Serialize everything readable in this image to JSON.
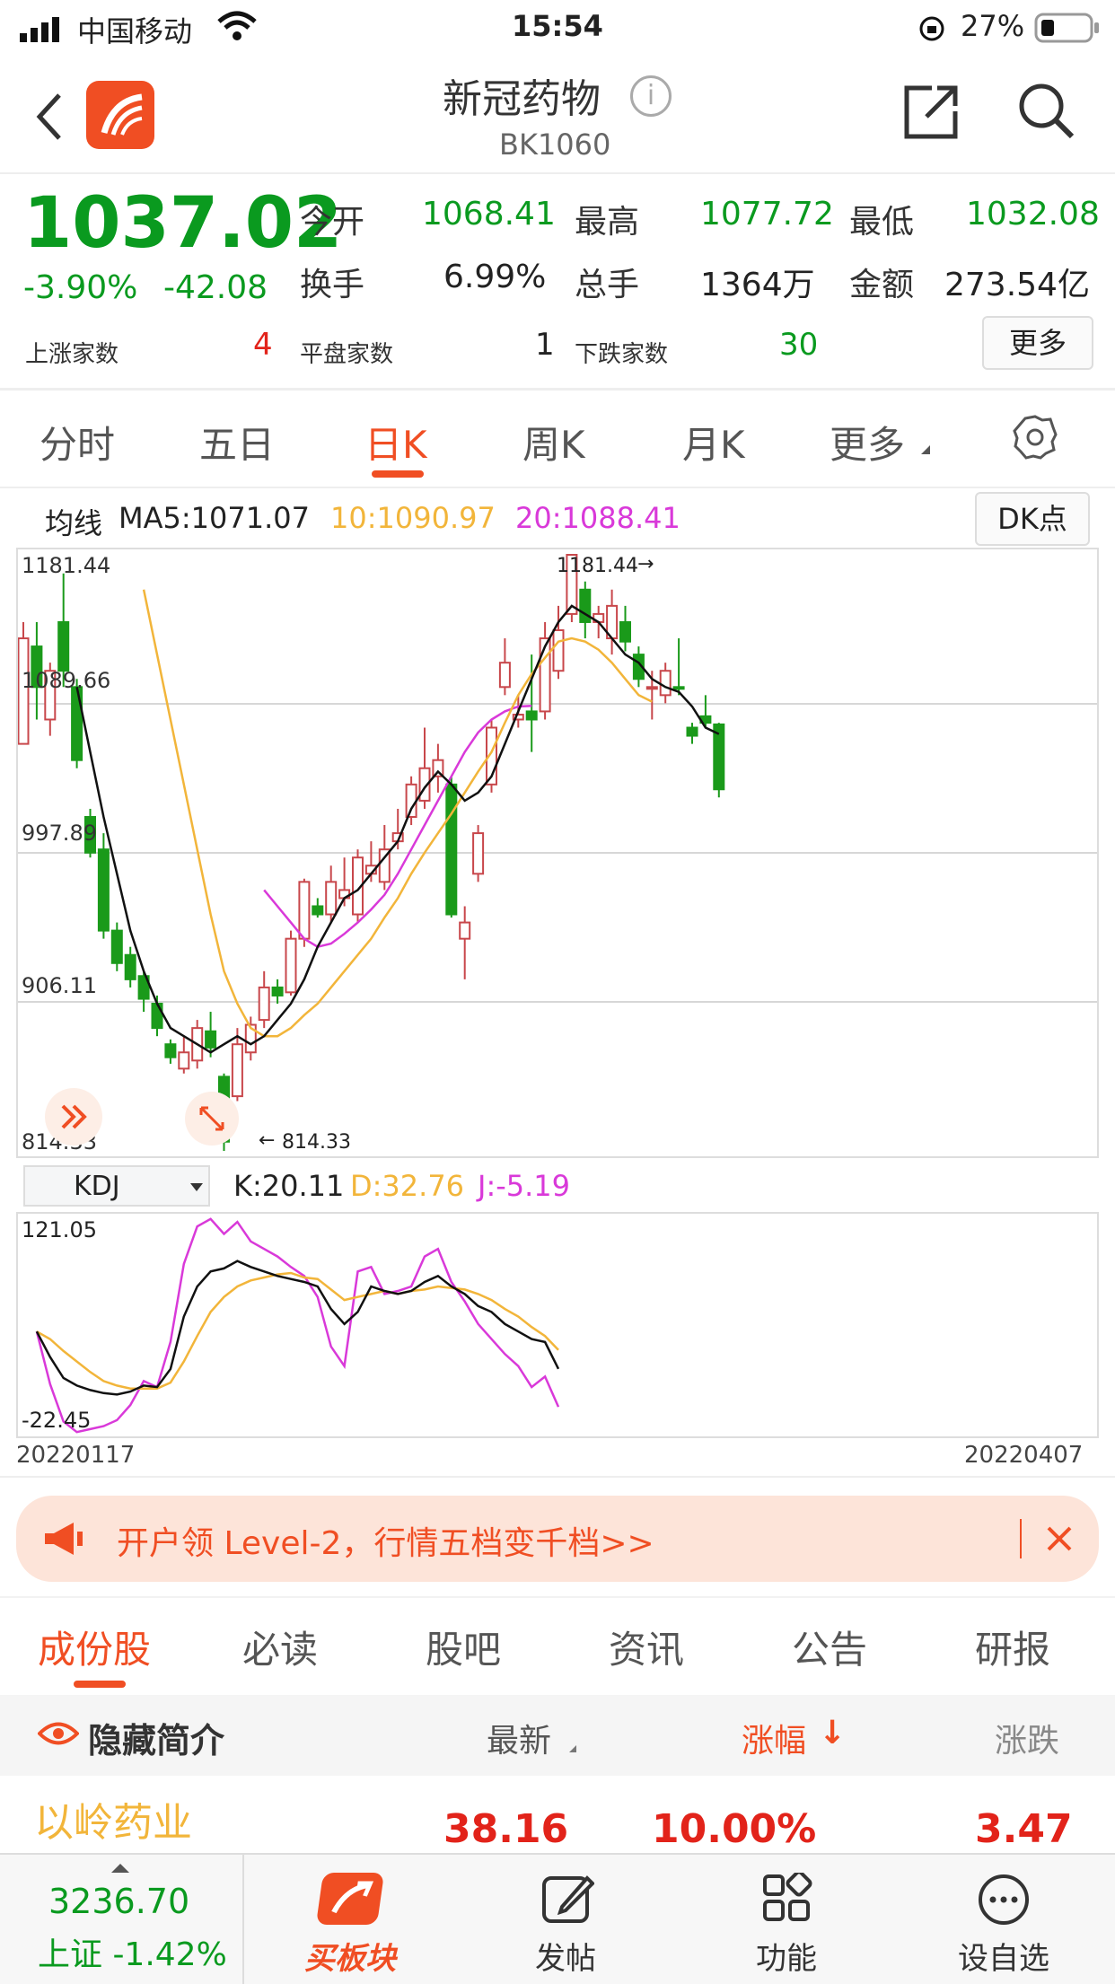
{
  "status_bar": {
    "carrier": "中国移动",
    "time": "15:54",
    "battery": "27%"
  },
  "nav": {
    "title": "新冠药物",
    "code": "BK1060",
    "info_icon": "i"
  },
  "quote": {
    "price": "1037.02",
    "pct": "-3.90%",
    "chg": "-42.08",
    "open_label": "今开",
    "open": "1068.41",
    "high_label": "最高",
    "high": "1077.72",
    "low_label": "最低",
    "low": "1032.08",
    "turnover_label": "换手",
    "turnover": "6.99%",
    "volume_label": "总手",
    "volume": "1364万",
    "amount_label": "金额",
    "amount": "273.54亿",
    "up_label": "上涨家数",
    "up": "4",
    "flat_label": "平盘家数",
    "flat": "1",
    "down_label": "下跌家数",
    "down": "30",
    "more_button": "更多"
  },
  "chart_tabs": [
    {
      "label": "分时"
    },
    {
      "label": "五日"
    },
    {
      "label": "日K"
    },
    {
      "label": "周K"
    },
    {
      "label": "月K"
    },
    {
      "label": "更多"
    }
  ],
  "ma": {
    "label": "均线",
    "ma5": "MA5:1071.07",
    "ma10": "10:1090.97",
    "ma20": "20:1088.41",
    "dk_button": "DK点"
  },
  "kdj": {
    "selector": "KDJ",
    "k": "K:20.11",
    "d": "D:32.76",
    "j": "J:-5.19"
  },
  "colors": {
    "up": "#c8474b",
    "down": "#1a9a1a",
    "ma5": "#111111",
    "ma10": "#f2b53a",
    "ma20": "#d939d9",
    "accent": "#f04e23"
  },
  "chart_data": [
    {
      "type": "candlestick",
      "ylim": [
        814.33,
        1181.44
      ],
      "yticks": [
        "1181.44",
        "1089.66",
        "997.89",
        "906.11",
        "814.33"
      ],
      "max_label": "1181.44",
      "min_label": "814.33",
      "x_start": "20220117",
      "x_end": "20220407",
      "candles": [
        {
          "o": 1065,
          "c": 1130,
          "h": 1140,
          "l": 1065
        },
        {
          "o": 1125,
          "c": 1100,
          "h": 1140,
          "l": 1080
        },
        {
          "o": 1080,
          "c": 1110,
          "h": 1115,
          "l": 1070
        },
        {
          "o": 1140,
          "c": 1110,
          "h": 1170,
          "l": 1100
        },
        {
          "o": 1100,
          "c": 1055,
          "h": 1105,
          "l": 1050
        },
        {
          "o": 1020,
          "c": 998,
          "h": 1025,
          "l": 995
        },
        {
          "o": 1000,
          "c": 950,
          "h": 1010,
          "l": 945
        },
        {
          "o": 950,
          "c": 930,
          "h": 955,
          "l": 925
        },
        {
          "o": 935,
          "c": 920,
          "h": 940,
          "l": 915
        },
        {
          "o": 922,
          "c": 908,
          "h": 925,
          "l": 900
        },
        {
          "o": 905,
          "c": 890,
          "h": 910,
          "l": 885
        },
        {
          "o": 880,
          "c": 872,
          "h": 883,
          "l": 868
        },
        {
          "o": 865,
          "c": 875,
          "h": 885,
          "l": 862
        },
        {
          "o": 870,
          "c": 890,
          "h": 895,
          "l": 865
        },
        {
          "o": 888,
          "c": 878,
          "h": 900,
          "l": 872
        },
        {
          "o": 860,
          "c": 820,
          "h": 862,
          "l": 814.33
        },
        {
          "o": 848,
          "c": 880,
          "h": 890,
          "l": 845
        },
        {
          "o": 875,
          "c": 892,
          "h": 897,
          "l": 870
        },
        {
          "o": 895,
          "c": 915,
          "h": 925,
          "l": 890
        },
        {
          "o": 915,
          "c": 910,
          "h": 920,
          "l": 905
        },
        {
          "o": 912,
          "c": 945,
          "h": 950,
          "l": 910
        },
        {
          "o": 945,
          "c": 980,
          "h": 982,
          "l": 940
        },
        {
          "o": 965,
          "c": 960,
          "h": 970,
          "l": 958
        },
        {
          "o": 960,
          "c": 980,
          "h": 990,
          "l": 955
        },
        {
          "o": 970,
          "c": 975,
          "h": 995,
          "l": 965
        },
        {
          "o": 960,
          "c": 995,
          "h": 1000,
          "l": 955
        },
        {
          "o": 985,
          "c": 990,
          "h": 1005,
          "l": 980
        },
        {
          "o": 980,
          "c": 1000,
          "h": 1015,
          "l": 975
        },
        {
          "o": 1005,
          "c": 1010,
          "h": 1025,
          "l": 1000
        },
        {
          "o": 1020,
          "c": 1040,
          "h": 1045,
          "l": 1015
        },
        {
          "o": 1030,
          "c": 1050,
          "h": 1075,
          "l": 1025
        },
        {
          "o": 1045,
          "c": 1055,
          "h": 1065,
          "l": 1035
        },
        {
          "o": 1040,
          "c": 960,
          "h": 1045,
          "l": 958
        },
        {
          "o": 945,
          "c": 955,
          "h": 965,
          "l": 920
        },
        {
          "o": 985,
          "c": 1010,
          "h": 1015,
          "l": 980
        },
        {
          "o": 1040,
          "c": 1075,
          "h": 1080,
          "l": 1035
        },
        {
          "o": 1100,
          "c": 1115,
          "h": 1130,
          "l": 1095
        },
        {
          "o": 1080,
          "c": 1083,
          "h": 1095,
          "l": 1075
        },
        {
          "o": 1085,
          "c": 1080,
          "h": 1120,
          "l": 1060
        },
        {
          "o": 1085,
          "c": 1130,
          "h": 1140,
          "l": 1080
        },
        {
          "o": 1110,
          "c": 1135,
          "h": 1150,
          "l": 1105
        },
        {
          "o": 1145,
          "c": 1181.44,
          "h": 1181.44,
          "l": 1140
        },
        {
          "o": 1160,
          "c": 1140,
          "h": 1165,
          "l": 1130
        },
        {
          "o": 1140,
          "c": 1145,
          "h": 1150,
          "l": 1130
        },
        {
          "o": 1130,
          "c": 1150,
          "h": 1160,
          "l": 1120
        },
        {
          "o": 1140,
          "c": 1128,
          "h": 1150,
          "l": 1122
        },
        {
          "o": 1120,
          "c": 1105,
          "h": 1125,
          "l": 1100
        },
        {
          "o": 1100,
          "c": 1100,
          "h": 1110,
          "l": 1080
        },
        {
          "o": 1095,
          "c": 1110,
          "h": 1115,
          "l": 1090
        },
        {
          "o": 1100,
          "c": 1099,
          "h": 1130,
          "l": 1095
        },
        {
          "o": 1075,
          "c": 1070,
          "h": 1078,
          "l": 1065
        },
        {
          "o": 1082,
          "c": 1078,
          "h": 1095,
          "l": 1075
        },
        {
          "o": 1077,
          "c": 1037,
          "h": 1078,
          "l": 1032
        }
      ],
      "ma5_start": 4,
      "ma10_start": 9,
      "ma20_start": 18,
      "ma5": [
        1100,
        1060,
        1020,
        985,
        950,
        925,
        905,
        890,
        885,
        880,
        875,
        880,
        885,
        880,
        885,
        895,
        905,
        920,
        940,
        955,
        970,
        975,
        985,
        995,
        1005,
        1025,
        1038,
        1048,
        1040,
        1030,
        1035,
        1045,
        1065,
        1085,
        1105,
        1125,
        1140,
        1150,
        1145,
        1140,
        1130,
        1120,
        1115,
        1105,
        1100,
        1097,
        1088,
        1075,
        1071.07
      ],
      "ma10": [
        1160,
        1120,
        1080,
        1040,
        1000,
        960,
        925,
        905,
        890,
        885,
        885,
        890,
        898,
        905,
        915,
        925,
        935,
        945,
        958,
        970,
        985,
        998,
        1010,
        1022,
        1035,
        1048,
        1060,
        1078,
        1095,
        1108,
        1118,
        1128,
        1130,
        1128,
        1123,
        1115,
        1105,
        1095,
        1090.97
      ],
      "ma20": [
        975,
        965,
        955,
        945,
        940,
        942,
        948,
        955,
        963,
        972,
        985,
        1000,
        1015,
        1030,
        1045,
        1060,
        1072,
        1080,
        1085,
        1088,
        1088.41
      ]
    },
    {
      "type": "line",
      "ylim": [
        -22.45,
        121.05
      ],
      "yticks": [
        "121.05",
        "-22.45"
      ],
      "x_start": "20220117",
      "x_end": "20220407",
      "start_index": 1,
      "K": [
        45,
        28,
        14,
        9,
        6,
        4,
        3,
        5,
        9,
        8,
        20,
        55,
        75,
        85,
        87,
        92,
        88,
        85,
        82,
        80,
        78,
        75,
        60,
        50,
        58,
        75,
        72,
        70,
        72,
        78,
        82,
        75,
        70,
        62,
        58,
        50,
        45,
        40,
        38,
        20.11
      ],
      "D": [
        45,
        40,
        32,
        25,
        18,
        12,
        9,
        7,
        7,
        7,
        11,
        25,
        42,
        58,
        68,
        75,
        79,
        81,
        83,
        84,
        81,
        80,
        73,
        66,
        68,
        70,
        72,
        70,
        72,
        73,
        75,
        74,
        73,
        70,
        66,
        60,
        55,
        48,
        42,
        32.76
      ],
      "J": [
        45,
        10,
        -15,
        -22,
        -20,
        -18,
        -14,
        -4,
        12,
        8,
        38,
        90,
        115,
        120,
        110,
        118,
        105,
        100,
        95,
        88,
        82,
        68,
        35,
        22,
        85,
        88,
        70,
        72,
        75,
        95,
        100,
        78,
        65,
        50,
        40,
        30,
        22,
        8,
        15,
        -5.19
      ]
    }
  ],
  "banner": {
    "text": "开户领 Level-2，行情五档变千档>>"
  },
  "section_tabs": [
    {
      "label": "成份股"
    },
    {
      "label": "必读"
    },
    {
      "label": "股吧"
    },
    {
      "label": "资讯"
    },
    {
      "label": "公告"
    },
    {
      "label": "研报"
    }
  ],
  "table": {
    "hide_intro": "隐藏简介",
    "col_latest": "最新",
    "col_pct": "涨幅",
    "col_chg": "涨跌",
    "rows": [
      {
        "name": "以岭药业",
        "latest": "38.16",
        "pct": "10.00%",
        "chg": "3.47"
      }
    ]
  },
  "bottom_bar": {
    "index_value": "3236.70",
    "index_label": "上证 -1.42%",
    "tabs": [
      {
        "label": "买板块"
      },
      {
        "label": "发帖"
      },
      {
        "label": "功能"
      },
      {
        "label": "设自选"
      }
    ]
  }
}
